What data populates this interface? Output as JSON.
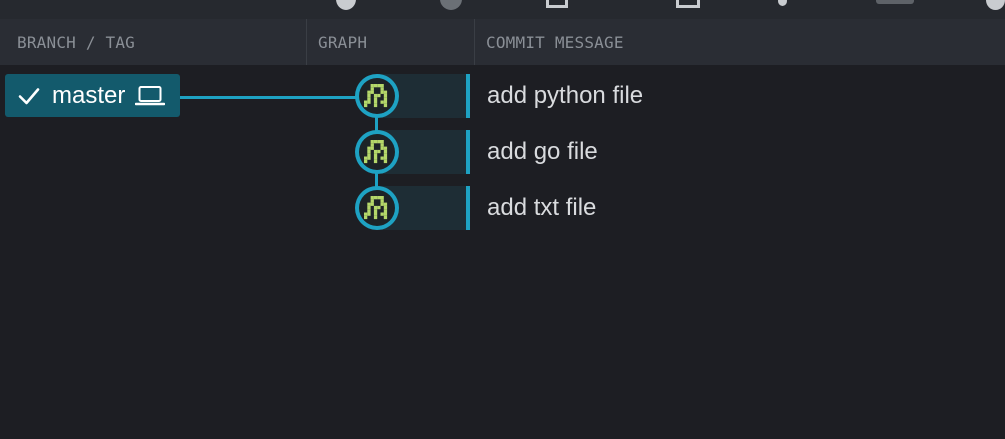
{
  "columns": {
    "branch_tag": "BRANCH / TAG",
    "graph": "GRAPH",
    "commit_message": "COMMIT MESSAGE"
  },
  "branch": {
    "name": "master",
    "checked_out": true,
    "icon": "laptop-icon"
  },
  "commits": [
    {
      "message": "add python file"
    },
    {
      "message": "add go file"
    },
    {
      "message": "add txt file"
    }
  ],
  "colors": {
    "accent": "#1ea2c3",
    "branch_bg": "#135a6c",
    "background": "#1d1e23",
    "header_bg": "#2a2d34",
    "avatar_pixels": "#b5d86a"
  }
}
